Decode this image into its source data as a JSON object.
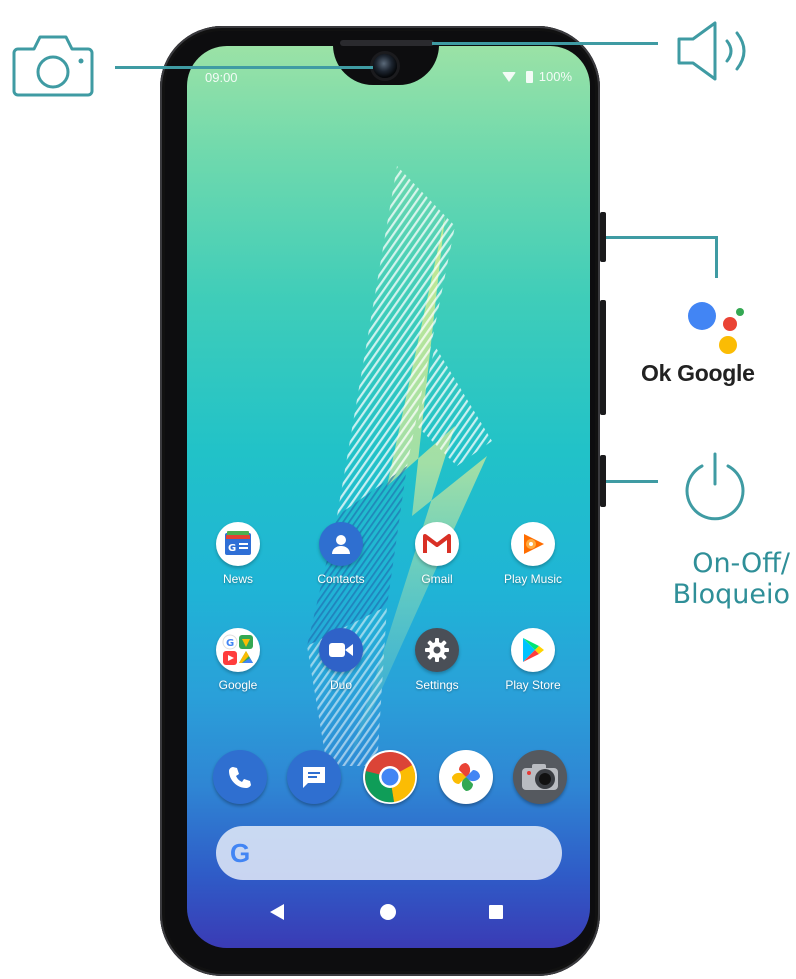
{
  "status_bar": {
    "time": "09:00",
    "battery": "100%"
  },
  "apps_row1": [
    {
      "label": "News",
      "icon": "google-news-icon"
    },
    {
      "label": "Contacts",
      "icon": "contacts-icon"
    },
    {
      "label": "Gmail",
      "icon": "gmail-icon"
    },
    {
      "label": "Play Music",
      "icon": "play-music-icon"
    }
  ],
  "apps_row2": [
    {
      "label": "Google",
      "icon": "google-folder-icon"
    },
    {
      "label": "Duo",
      "icon": "duo-icon"
    },
    {
      "label": "Settings",
      "icon": "settings-gear-icon"
    },
    {
      "label": "Play Store",
      "icon": "play-store-icon"
    }
  ],
  "dock": [
    "phone-icon",
    "messages-icon",
    "chrome-icon",
    "photos-icon",
    "camera-icon"
  ],
  "search": {
    "logo": "G"
  },
  "nav": [
    "back-icon",
    "home-icon",
    "recents-icon"
  ],
  "annotations": {
    "ok_google": "Ok Google",
    "power_line1": "On-Off/",
    "power_line2": "Bloqueio"
  },
  "colors": {
    "accent": "#3f9ba3",
    "phone_body": "#0d0d0f"
  }
}
